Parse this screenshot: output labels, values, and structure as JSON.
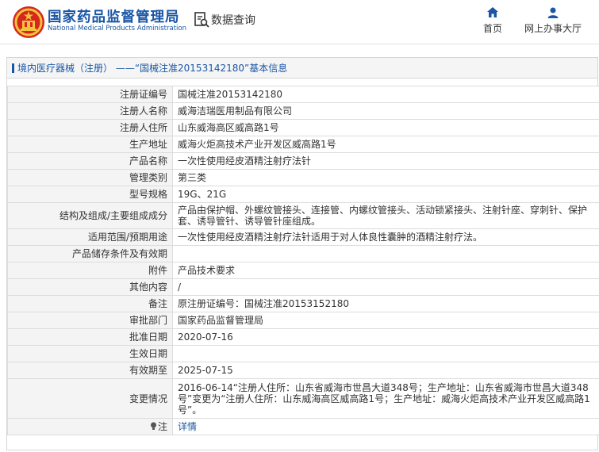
{
  "header": {
    "brand_cn": "国家药品监督管理局",
    "brand_en": "National Medical Products Administration",
    "query_label": "数据查询",
    "nav": [
      {
        "label": "首页",
        "icon": "home-icon"
      },
      {
        "label": "网上办事大厅",
        "icon": "user-icon"
      }
    ]
  },
  "breadcrumb": {
    "text": "境内医疗器械（注册） ——“国械注准20153142180”基本信息"
  },
  "colors": {
    "brand_blue": "#1a56a5",
    "label_bg": "#f4f4f4",
    "border": "#dcdcdc"
  },
  "rows": [
    {
      "key": "注册证编号",
      "value": "国械注准20153142180"
    },
    {
      "key": "注册人名称",
      "value": "威海洁瑞医用制品有限公司"
    },
    {
      "key": "注册人住所",
      "value": "山东威海高区威高路1号"
    },
    {
      "key": "生产地址",
      "value": "威海火炬高技术产业开发区威高路1号"
    },
    {
      "key": "产品名称",
      "value": "一次性使用经皮酒精注射疗法针"
    },
    {
      "key": "管理类别",
      "value": "第三类"
    },
    {
      "key": "型号规格",
      "value": "19G、21G"
    },
    {
      "key": "结构及组成/主要组成成分",
      "value": "产品由保护帽、外螺纹管接头、连接管、内螺纹管接头、活动锁紧接头、注射针座、穿刺针、保护套、诱导管针、诱导管针座组成。"
    },
    {
      "key": "适用范围/预期用途",
      "value": "一次性使用经皮酒精注射疗法针适用于对人体良性囊肿的酒精注射疗法。"
    },
    {
      "key": "产品储存条件及有效期",
      "value": ""
    },
    {
      "key": "附件",
      "value": "产品技术要求"
    },
    {
      "key": "其他内容",
      "value": "/"
    },
    {
      "key": "备注",
      "value": "原注册证编号：国械注准20153152180"
    },
    {
      "key": "审批部门",
      "value": "国家药品监督管理局"
    },
    {
      "key": "批准日期",
      "value": "2020-07-16"
    },
    {
      "key": "生效日期",
      "value": ""
    },
    {
      "key": "有效期至",
      "value": "2025-07-15"
    },
    {
      "key": "变更情况",
      "value": "2016-06-14“注册人住所：山东省威海市世昌大道348号；生产地址：山东省威海市世昌大道348号”变更为“注册人住所：山东威海高区威高路1号；生产地址：威海火炬高技术产业开发区威高路1号”。"
    }
  ],
  "note": {
    "key": "注",
    "value": "详情",
    "icon": "lightbulb-icon"
  }
}
